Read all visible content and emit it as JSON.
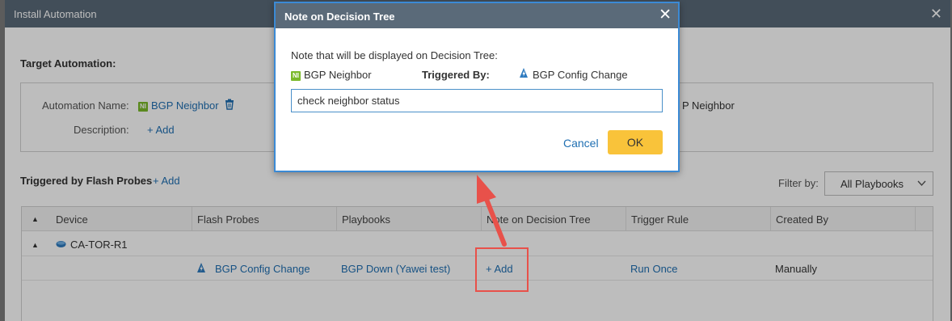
{
  "background_window": {
    "title": "Install Automation",
    "close_glyph": "✕",
    "target_automation_title": "Target Automation:",
    "automation_name_label": "Automation Name:",
    "automation_name_value": "BGP Neighbor",
    "automation_badge": "NI",
    "automation_name_right_partial": "P Neighbor",
    "description_label": "Description:",
    "description_add": "+ Add",
    "triggered_title": "Triggered by Flash Probes",
    "triggered_add": "+ Add",
    "filter_label": "Filter by:",
    "filter_value": "All Playbooks",
    "table": {
      "columns": [
        "Device",
        "Flash Probes",
        "Playbooks",
        "Note on Decision Tree",
        "Trigger Rule",
        "Created By"
      ],
      "group_device": "CA-TOR-R1",
      "rows": [
        {
          "flash_probe": "BGP Config Change",
          "playbook": "BGP Down (Yawei test)",
          "note": "+ Add",
          "trigger_rule": "Run Once",
          "created_by": "Manually"
        }
      ]
    }
  },
  "modal": {
    "title": "Note on Decision Tree",
    "close_glyph": "✕",
    "description": "Note that will be displayed on Decision Tree:",
    "automation_badge": "NI",
    "automation_name": "BGP Neighbor",
    "triggered_by_label": "Triggered By:",
    "triggered_by_value": "BGP Config Change",
    "note_value": "check neighbor status",
    "cancel_label": "Cancel",
    "ok_label": "OK"
  },
  "colors": {
    "titlebar": "#5a6a79",
    "link": "#1f6fb2",
    "ok_button": "#f9c33a",
    "annotation": "#e8514a",
    "badge": "#7ab929"
  }
}
